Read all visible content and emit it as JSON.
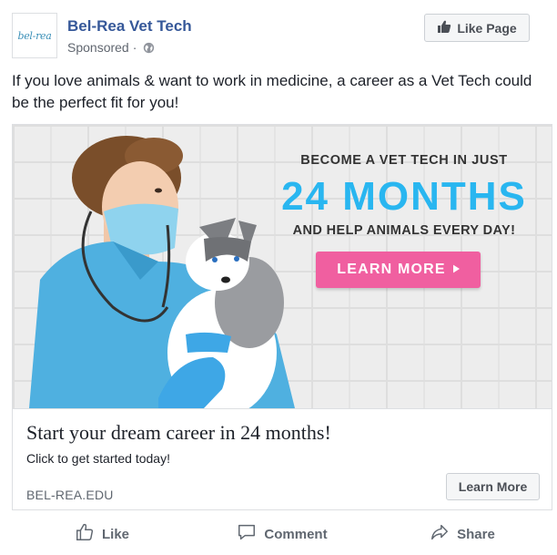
{
  "header": {
    "avatar_text": "bel-rea",
    "page_name": "Bel-Rea Vet Tech",
    "sponsored": "Sponsored",
    "separator": "·",
    "like_page_label": "Like Page"
  },
  "post": {
    "text": "If you love animals & want to work in medicine, a career as a Vet Tech could be the perfect fit for you!"
  },
  "ad": {
    "image": {
      "top_line": "BECOME A VET TECH IN JUST",
      "big_line": "24 MONTHS",
      "bottom_line": "AND HELP ANIMALS EVERY DAY!",
      "cta_label": "LEARN MORE",
      "cta_color": "#f05fa0",
      "accent_color": "#29b6f0"
    },
    "title": "Start your dream career in 24 months!",
    "description": "Click to get started today!",
    "domain": "BEL-REA.EDU",
    "button_label": "Learn More"
  },
  "actions": {
    "like": "Like",
    "comment": "Comment",
    "share": "Share"
  },
  "icons": {
    "globe": "globe-icon",
    "thumb": "thumbs-up-icon",
    "comment": "comment-bubble-icon",
    "share": "share-arrow-icon",
    "cta_arrow": "triangle-right-icon"
  },
  "colors": {
    "link_blue": "#365899",
    "muted_text": "#616770"
  }
}
